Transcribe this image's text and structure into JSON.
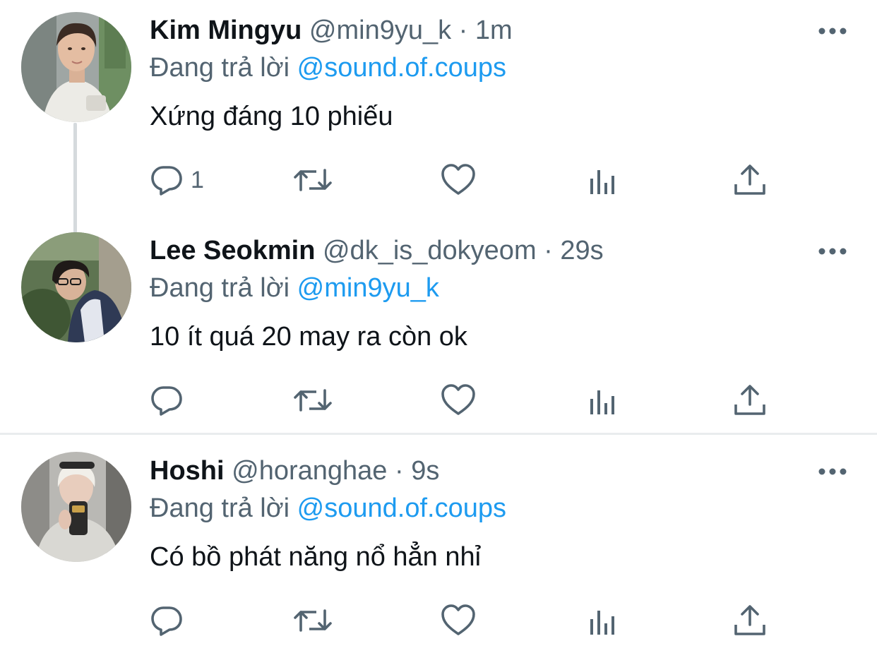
{
  "tweets": [
    {
      "name": "Kim Mingyu",
      "handle": "@min9yu_k",
      "separator": "·",
      "time": "1m",
      "reply_prefix": "Đang trả lời",
      "reply_to": "@sound.of.coups",
      "text": "Xứng đáng 10 phiếu",
      "reply_count": "1"
    },
    {
      "name": "Lee Seokmin",
      "handle": "@dk_is_dokyeom",
      "separator": "·",
      "time": "29s",
      "reply_prefix": "Đang trả lời",
      "reply_to": "@min9yu_k",
      "text": "10 ít quá 20 may ra còn ok",
      "reply_count": ""
    },
    {
      "name": "Hoshi",
      "handle": "@horanghae",
      "separator": "·",
      "time": "9s",
      "reply_prefix": "Đang trả lời",
      "reply_to": "@sound.of.coups",
      "text": "Có bồ phát năng nổ hẳn nhỉ",
      "reply_count": ""
    }
  ],
  "icons": {
    "reply": "reply-icon",
    "retweet": "retweet-icon",
    "like": "like-icon",
    "stats": "stats-icon",
    "share": "share-icon",
    "more": "more-icon"
  },
  "colors": {
    "text": "#0f1419",
    "secondary": "#536471",
    "mention": "#1d9bf0",
    "divider": "#e9ecee",
    "thread_line": "#d5dadd"
  }
}
